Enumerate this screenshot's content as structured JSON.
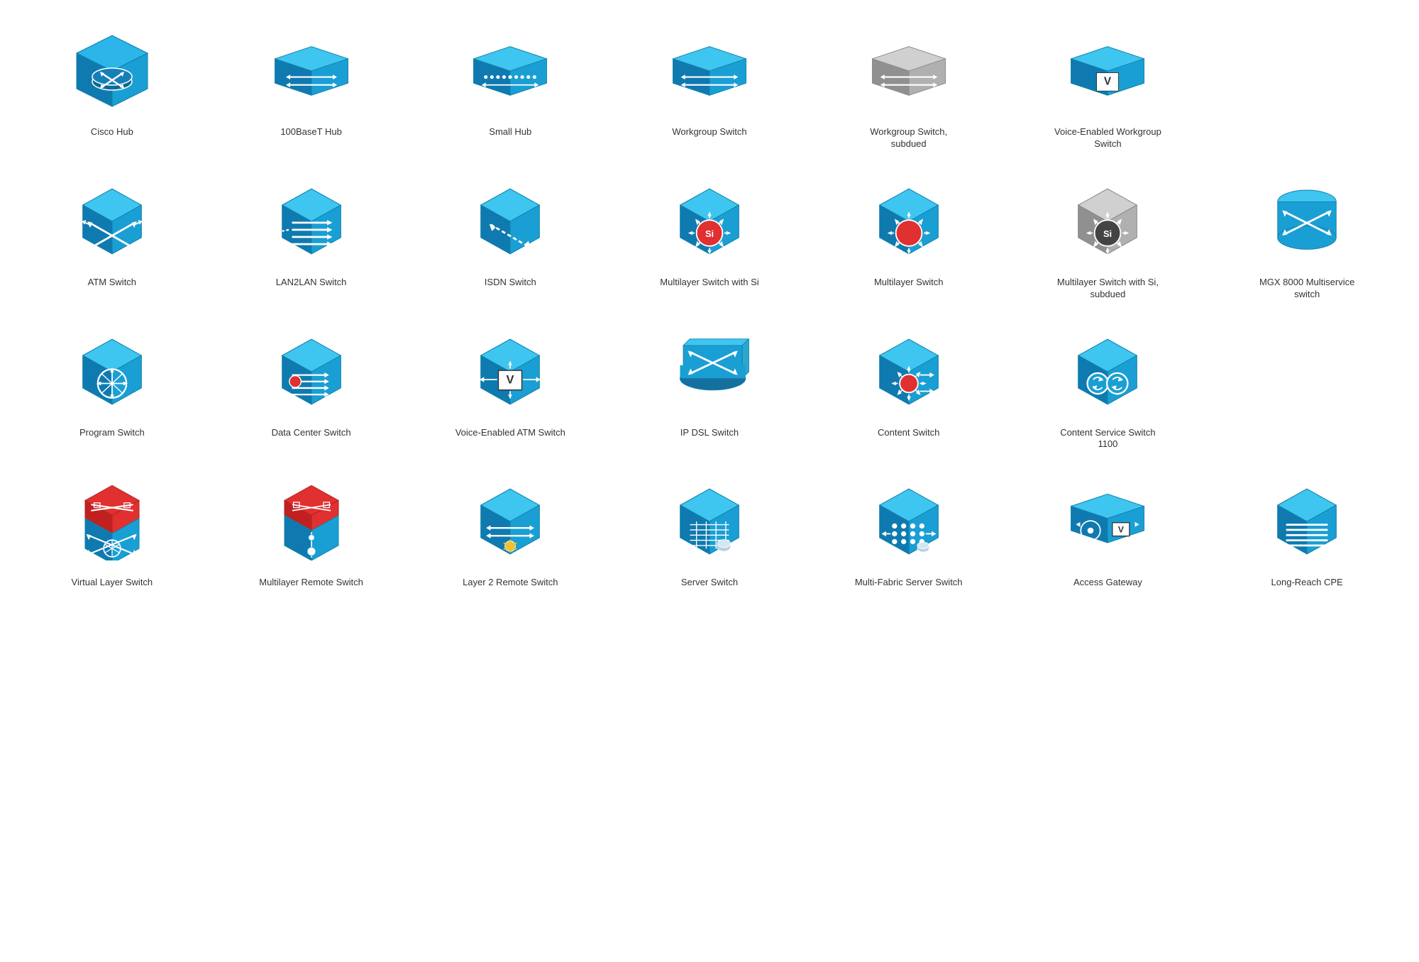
{
  "items": [
    {
      "id": "cisco-hub",
      "label": "Cisco Hub",
      "row": 1
    },
    {
      "id": "100baset-hub",
      "label": "100BaseT Hub",
      "row": 1
    },
    {
      "id": "small-hub",
      "label": "Small Hub",
      "row": 1
    },
    {
      "id": "workgroup-switch",
      "label": "Workgroup Switch",
      "row": 1
    },
    {
      "id": "workgroup-switch-subdued",
      "label": "Workgroup Switch, subdued",
      "row": 1
    },
    {
      "id": "voice-enabled-workgroup-switch",
      "label": "Voice-Enabled Workgroup Switch",
      "row": 1
    },
    {
      "id": "spacer1",
      "label": "",
      "row": 1
    },
    {
      "id": "atm-switch",
      "label": "ATM Switch",
      "row": 2
    },
    {
      "id": "lan2lan-switch",
      "label": "LAN2LAN Switch",
      "row": 2
    },
    {
      "id": "isdn-switch",
      "label": "ISDN Switch",
      "row": 2
    },
    {
      "id": "multilayer-switch-si",
      "label": "Multilayer Switch with Si",
      "row": 2
    },
    {
      "id": "multilayer-switch",
      "label": "Multilayer Switch",
      "row": 2
    },
    {
      "id": "multilayer-switch-si-subdued",
      "label": "Multilayer Switch with Si, subdued",
      "row": 2
    },
    {
      "id": "mgx-8000",
      "label": "MGX 8000 Multiservice switch",
      "row": 2
    },
    {
      "id": "program-switch",
      "label": "Program Switch",
      "row": 3
    },
    {
      "id": "data-center-switch",
      "label": "Data Center Switch",
      "row": 3
    },
    {
      "id": "voice-enabled-atm-switch",
      "label": "Voice-Enabled ATM Switch",
      "row": 3
    },
    {
      "id": "ip-dsl-switch",
      "label": "IP DSL Switch",
      "row": 3
    },
    {
      "id": "content-switch",
      "label": "Content Switch",
      "row": 3
    },
    {
      "id": "content-service-switch-1100",
      "label": "Content Service Switch 1100",
      "row": 3
    },
    {
      "id": "spacer3",
      "label": "",
      "row": 3
    },
    {
      "id": "virtual-layer-switch",
      "label": "Virtual Layer Switch",
      "row": 4
    },
    {
      "id": "multilayer-remote-switch",
      "label": "Multilayer Remote Switch",
      "row": 4
    },
    {
      "id": "layer2-remote-switch",
      "label": "Layer 2 Remote Switch",
      "row": 4
    },
    {
      "id": "server-switch",
      "label": "Server Switch",
      "row": 4
    },
    {
      "id": "multi-fabric-server-switch",
      "label": "Multi-Fabric Server Switch",
      "row": 4
    },
    {
      "id": "access-gateway",
      "label": "Access Gateway",
      "row": 4
    },
    {
      "id": "long-reach-cpe",
      "label": "Long-Reach CPE",
      "row": 4
    }
  ]
}
